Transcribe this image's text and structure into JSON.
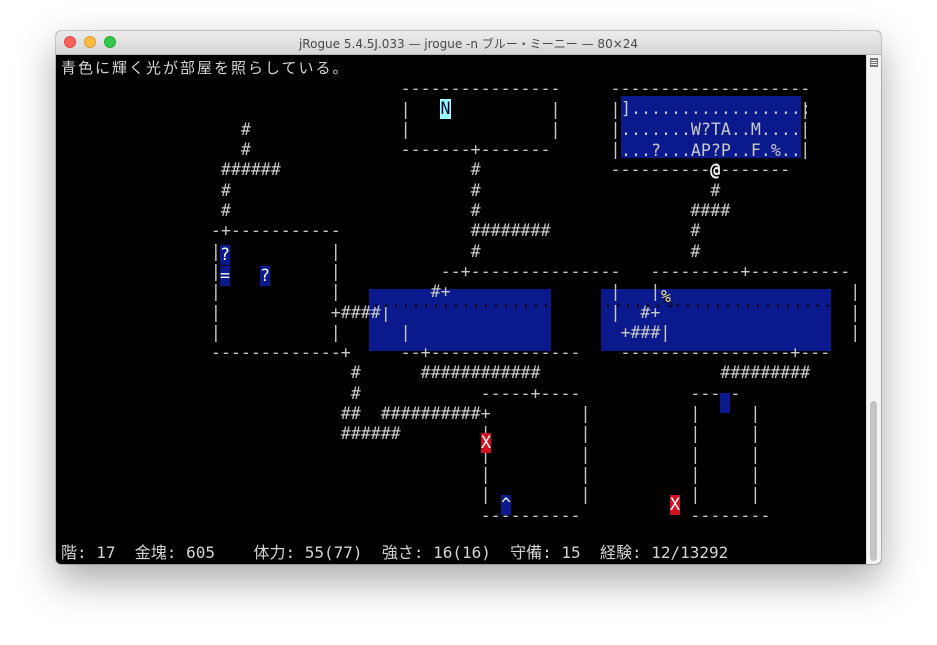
{
  "window": {
    "title": "jRogue 5.4.5J.033 — jrogue -n ブルー・ミーニー — 80×24"
  },
  "terminal": {
    "message": "青色に輝く光が部屋を照らしている。",
    "status": "階: 17  金塊: 605    体力: 55(77)  強さ: 16(16)  守備: 15  経験: 12/13292",
    "map_rows": [
      "",
      "                                  ----------------     -------------------- ",
      "                                  |              |     |                  | ",
      "                  #               |              |     |                  | ",
      "                  #               -------+-------      |                  | ",
      "                ######                   #             ----------@------- ",
      "                #                        #                       #        ",
      "                #                        #                     ####       ",
      "               -+-----------             ########              #          ",
      "               |           |             #                     #          ",
      "               |           |          --+---------------   ---------+---------- ",
      "               |           |         #+                |   |                   |",
      "               |           +####|                      |  #+                   |",
      "               |           |      |                     +###|                  |",
      "               -------------+     --+---------------    -----------------+--- ",
      "                             #      ############                  ######### ",
      "                             #            -----+----           -----      ",
      "                            ##  ##########+         |          |     |     ",
      "                            ######        |         |          |     |     ",
      "                                          |         |          |     |     ",
      "                                          |         |          |     |     ",
      "                                          |         |          |     |     ",
      "                                          ----------           --------    "
    ],
    "colors": {
      "background": "#000000",
      "text": "#c8c8c8",
      "room_fill": "#0a1a8c",
      "player": "#ffffff",
      "monster_cyan": "#3fd0e0",
      "monster_magenta": "#e040e0",
      "item_yellow": "#f0e090",
      "trap_red": "#d01020",
      "monster_green": "#50c850",
      "monster_blue": "#4060ff"
    },
    "room_top_right": {
      "line1": "].................:",
      "line2": ".......W?TA..M....",
      "line3": "...?...AP?P..F.%.."
    },
    "tokens": {
      "n_monster": "N",
      "scroll1": "?",
      "scroll2": "?",
      "ring": "=",
      "food": "%",
      "trap1": "X",
      "trap2": "X",
      "trap_arrow": "^",
      "player": "@"
    },
    "room_middle_left": "...................",
    "room_middle_right": "......%....................."
  }
}
